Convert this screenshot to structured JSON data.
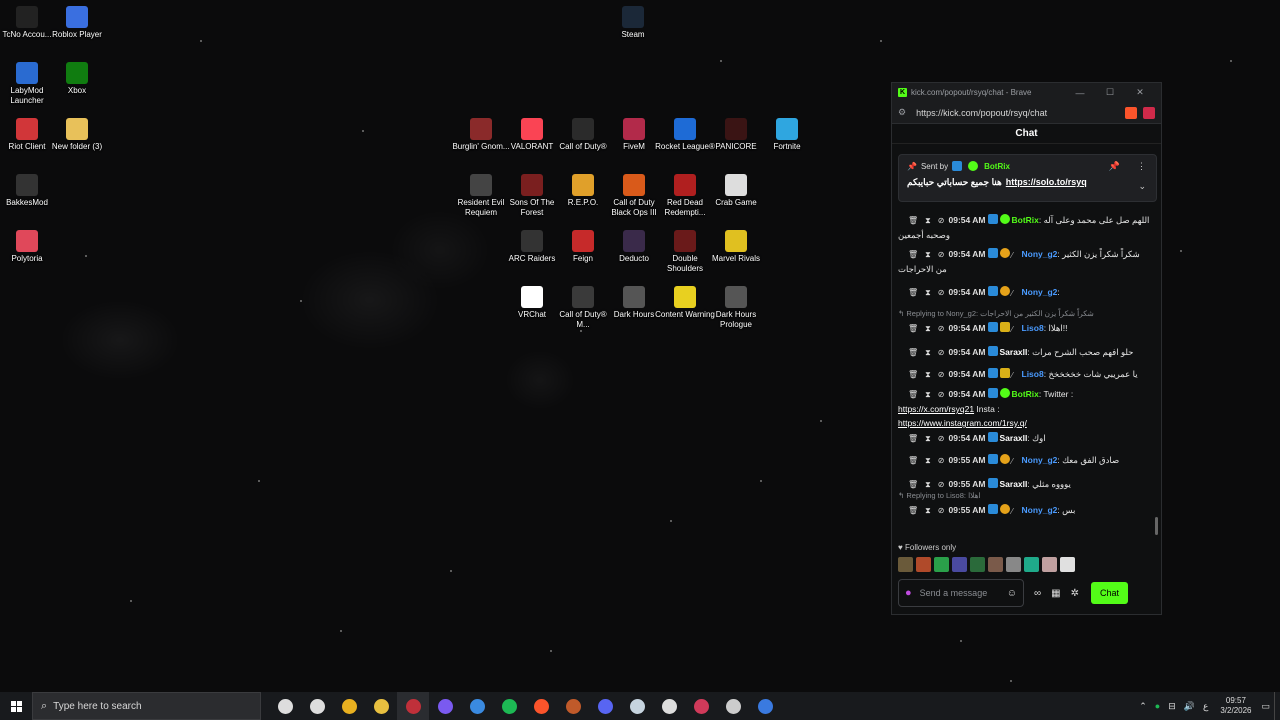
{
  "desktop": {
    "icons": [
      {
        "label": "TcNo Accou...",
        "color": "#222"
      },
      {
        "label": "Roblox Player",
        "color": "#3a6fe0"
      },
      {
        "label": "LabyMod Launcher",
        "color": "#2a6bd1"
      },
      {
        "label": "Xbox",
        "color": "#107c10"
      },
      {
        "label": "Riot Client",
        "color": "#d13639"
      },
      {
        "label": "New folder (3)",
        "color": "#e8c15a"
      },
      {
        "label": "BakkesMod",
        "color": "#333"
      },
      {
        "label": "Polytoria",
        "color": "#e0485a"
      },
      {
        "label": "Steam",
        "color": "#1b2838"
      },
      {
        "label": "Burglin' Gnom...",
        "color": "#8a2a2a"
      },
      {
        "label": "VALORANT",
        "color": "#fa4454"
      },
      {
        "label": "Call of Duty®",
        "color": "#2b2b2b"
      },
      {
        "label": "FiveM",
        "color": "#b22a4a"
      },
      {
        "label": "Rocket League®",
        "color": "#1e6bd6"
      },
      {
        "label": "PANICORE",
        "color": "#3a1414"
      },
      {
        "label": "Fortnite",
        "color": "#2fa6e0"
      },
      {
        "label": "Resident Evil Requiem",
        "color": "#444"
      },
      {
        "label": "Sons Of The Forest",
        "color": "#7a1f1f"
      },
      {
        "label": "R.E.P.O.",
        "color": "#e0a02a"
      },
      {
        "label": "Call of Duty Black Ops III",
        "color": "#d95a1a"
      },
      {
        "label": "Red Dead Redempti...",
        "color": "#b01f1f"
      },
      {
        "label": "Crab Game",
        "color": "#ddd"
      },
      {
        "label": "ARC Raiders",
        "color": "#333"
      },
      {
        "label": "Feign",
        "color": "#c62a2a"
      },
      {
        "label": "Deducto",
        "color": "#3a2a4a"
      },
      {
        "label": "Double Shoulders",
        "color": "#6a1a1a"
      },
      {
        "label": "Marvel Rivals",
        "color": "#e0c020"
      },
      {
        "label": "VRChat",
        "color": "#ffffff"
      },
      {
        "label": "Call of Duty® M...",
        "color": "#3a3a3a"
      },
      {
        "label": "Dark Hours",
        "color": "#555"
      },
      {
        "label": "Content Warning",
        "color": "#e8d020"
      },
      {
        "label": "Dark Hours Prologue",
        "color": "#555"
      }
    ]
  },
  "browser": {
    "title": "kick.com/popout/rsyq/chat - Brave",
    "url": "https://kick.com/popout/rsyq/chat",
    "min": "—",
    "max": "☐",
    "close": "✕"
  },
  "chat": {
    "header": "Chat",
    "pinned": {
      "sent_by": "Sent by",
      "bot": "BotRix",
      "text": "هنا جميع حساباتي حبايبكم",
      "link": "https://solo.to/rsyq"
    },
    "messages": [
      {
        "time": "09:54 AM",
        "user": "BotRix",
        "color": "#53fc18",
        "badges": [
          "blue",
          "green"
        ],
        "text": "اللهم صل على محمد وعلى آله وصحبه أجمعين"
      },
      {
        "time": "09:54 AM",
        "user": "Nony_g2",
        "color": "#4a9bff",
        "badges": [
          "blue",
          "gold",
          "slash"
        ],
        "text": "شكراً شكراً يزن الكثير من الاحراجات"
      },
      {
        "time": "09:54 AM",
        "user": "Nony_g2",
        "color": "#4a9bff",
        "badges": [
          "blue",
          "gold",
          "slash"
        ],
        "text": ""
      },
      {
        "reply": "Replying to Nony_g2:",
        "reply_text": "شكراً شكراً يزن الكثير من الاحراجات",
        "time": "09:54 AM",
        "user": "Liso8",
        "color": "#4a9bff",
        "badges": [
          "blue",
          "crown",
          "slash"
        ],
        "text": "اهلاا!!"
      },
      {
        "time": "09:54 AM",
        "user": "Saraxll",
        "color": "#ffffff",
        "badges": [
          "blue"
        ],
        "text": "حلو افهم صحب الشرح مرات"
      },
      {
        "time": "09:54 AM",
        "user": "Liso8",
        "color": "#4a9bff",
        "badges": [
          "blue",
          "crown",
          "slash"
        ],
        "text": "يا عمريبي شات خخخخخخ"
      },
      {
        "time": "09:54 AM",
        "user": "BotRix",
        "color": "#53fc18",
        "badges": [
          "blue",
          "green"
        ],
        "text": "Twitter :",
        "link1": "https://x.com/rsyq21",
        "mid": "Insta :",
        "link2": "https://www.instagram.com/1rsy.q/"
      },
      {
        "time": "09:54 AM",
        "user": "Saraxll",
        "color": "#ffffff",
        "badges": [
          "blue"
        ],
        "text": "اوك"
      },
      {
        "time": "09:55 AM",
        "user": "Nony_g2",
        "color": "#4a9bff",
        "badges": [
          "blue",
          "gold",
          "slash"
        ],
        "text": "صادق الفق معك"
      },
      {
        "time": "09:55 AM",
        "user": "Saraxll",
        "color": "#ffffff",
        "badges": [
          "blue"
        ],
        "text": "يوووه مثلي"
      },
      {
        "reply": "Replying to Liso8:",
        "reply_text": "اهلاا",
        "time": "09:55 AM",
        "user": "Nony_g2",
        "color": "#4a9bff",
        "badges": [
          "blue",
          "gold",
          "slash"
        ],
        "text": "بس"
      }
    ],
    "followers_only": "Followers only",
    "emotes": [
      "#6a5a3a",
      "#b04a2a",
      "#2aa04a",
      "#4a4aa0",
      "#2a6a3a",
      "#7a5a4a",
      "#888",
      "#1faa8a",
      "#c0a0a0",
      "#e0e0e0"
    ],
    "input_placeholder": "Send a message",
    "send_button": "Chat"
  },
  "taskbar": {
    "search_placeholder": "Type here to search",
    "apps": [
      {
        "name": "task-view-icon",
        "color": "#ddd"
      },
      {
        "name": "steelseries-icon",
        "color": "#ddd"
      },
      {
        "name": "chrome-icon",
        "color": "#e8b020"
      },
      {
        "name": "file-explorer-icon",
        "color": "#e8c040"
      },
      {
        "name": "tcno-icon",
        "color": "#c0303a"
      },
      {
        "name": "discord-ptb-icon",
        "color": "#7a5af0"
      },
      {
        "name": "app-window-icon",
        "color": "#3a8ae0"
      },
      {
        "name": "spotify-icon",
        "color": "#1db954"
      },
      {
        "name": "brave-icon",
        "color": "#fb542b"
      },
      {
        "name": "game-icon",
        "color": "#c05a2a"
      },
      {
        "name": "discord-icon",
        "color": "#5865f2"
      },
      {
        "name": "steam-icon",
        "color": "#c6d4df"
      },
      {
        "name": "g-icon",
        "color": "#ddd"
      },
      {
        "name": "music-icon",
        "color": "#d03a5a"
      },
      {
        "name": "record-icon",
        "color": "#ccc"
      },
      {
        "name": "vpn-icon",
        "color": "#3a7ae0"
      }
    ],
    "tray_lang": "ع",
    "time": "09:57",
    "date": "3/2/2026"
  }
}
